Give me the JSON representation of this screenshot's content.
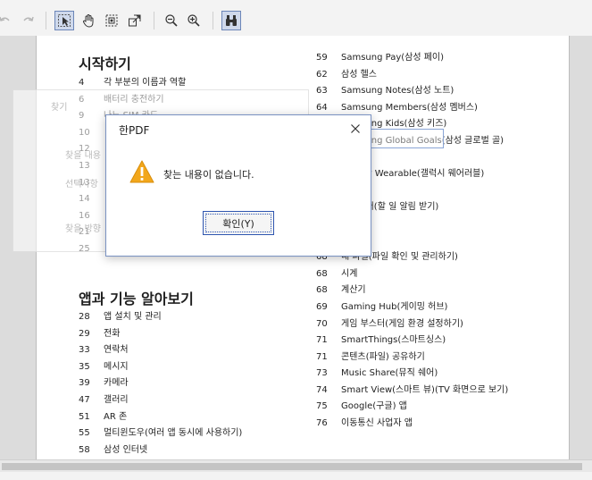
{
  "toolbar": {
    "buttons": [
      "undo",
      "redo",
      "select-tool",
      "hand-tool",
      "snapshot",
      "fit-page",
      "zoom-out",
      "zoom-in",
      "find"
    ]
  },
  "left_toc": {
    "section1_title": "시작하기",
    "section1_items": [
      {
        "num": "4",
        "text": "각 부분의 이름과 역할"
      },
      {
        "num": "6",
        "text": "배터리 충전하기"
      },
      {
        "num": "9",
        "text": "나노 SIM 카드"
      },
      {
        "num": "10",
        "text": ""
      },
      {
        "num": "12",
        "text": ""
      },
      {
        "num": "13",
        "text": ""
      },
      {
        "num": "13",
        "text": ""
      },
      {
        "num": "14",
        "text": ""
      },
      {
        "num": "16",
        "text": ""
      },
      {
        "num": "21",
        "text": ""
      },
      {
        "num": "25",
        "text": ""
      }
    ],
    "section2_title": "앱과 기능 알아보기",
    "section2_items": [
      {
        "num": "28",
        "text": "앱 설치 및 관리"
      },
      {
        "num": "29",
        "text": "전화"
      },
      {
        "num": "33",
        "text": "연락처"
      },
      {
        "num": "35",
        "text": "메시지"
      },
      {
        "num": "39",
        "text": "카메라"
      },
      {
        "num": "47",
        "text": "갤러리"
      },
      {
        "num": "51",
        "text": "AR 존"
      },
      {
        "num": "55",
        "text": "멀티윈도우(여러 앱 동시에 사용하기)"
      },
      {
        "num": "58",
        "text": "삼성 인터넷"
      }
    ]
  },
  "right_toc": {
    "items": [
      {
        "num": "59",
        "text": "Samsung Pay(삼성 페이)"
      },
      {
        "num": "62",
        "text": "삼성 헬스"
      },
      {
        "num": "63",
        "text": "Samsung Notes(삼성 노트)"
      },
      {
        "num": "64",
        "text": "Samsung Members(삼성 멤버스)"
      },
      {
        "num": "",
        "text": "Samsung Kids(삼성 키즈)"
      },
      {
        "num": "",
        "text": "Samsung Global Goals(삼성 글로벌 골)"
      },
      {
        "num": "",
        "text": ""
      },
      {
        "num": "",
        "text": "Galaxy Wearable(갤럭시 웨어러블)"
      },
      {
        "num": "",
        "text": ""
      },
      {
        "num": "",
        "text": "리마인더(할 일 알림 받기)"
      },
      {
        "num": "",
        "text": ""
      },
      {
        "num": "",
        "text": "음"
      },
      {
        "num": "68",
        "text": "내 파일(파일 확인 및 관리하기)"
      },
      {
        "num": "68",
        "text": "시계"
      },
      {
        "num": "68",
        "text": "계산기"
      },
      {
        "num": "69",
        "text": "Gaming Hub(게이밍 허브)"
      },
      {
        "num": "70",
        "text": "게임 부스터(게임 환경 설정하기)"
      },
      {
        "num": "71",
        "text": "SmartThings(스마트싱스)"
      },
      {
        "num": "71",
        "text": "콘텐츠(파일) 공유하기"
      },
      {
        "num": "73",
        "text": "Music Share(뮤직 쉐어)"
      },
      {
        "num": "74",
        "text": "Smart View(스마트 뷰)(TV 화면으로 보기)"
      },
      {
        "num": "75",
        "text": "Google(구글) 앱"
      },
      {
        "num": "76",
        "text": "이동통신 사업자 앱"
      }
    ]
  },
  "find_panel_ghost": {
    "find_label": "찾기",
    "row1": "찾을 내용",
    "row2": "선택사항",
    "row3": "대",
    "row4": "찾을 방향",
    "row5": "아"
  },
  "dialog": {
    "title": "한PDF",
    "message": "찾는 내용이 없습니다.",
    "ok_label": "확인(Y)"
  },
  "colors": {
    "accent": "#2f56b0",
    "warning": "#f2a71b"
  }
}
